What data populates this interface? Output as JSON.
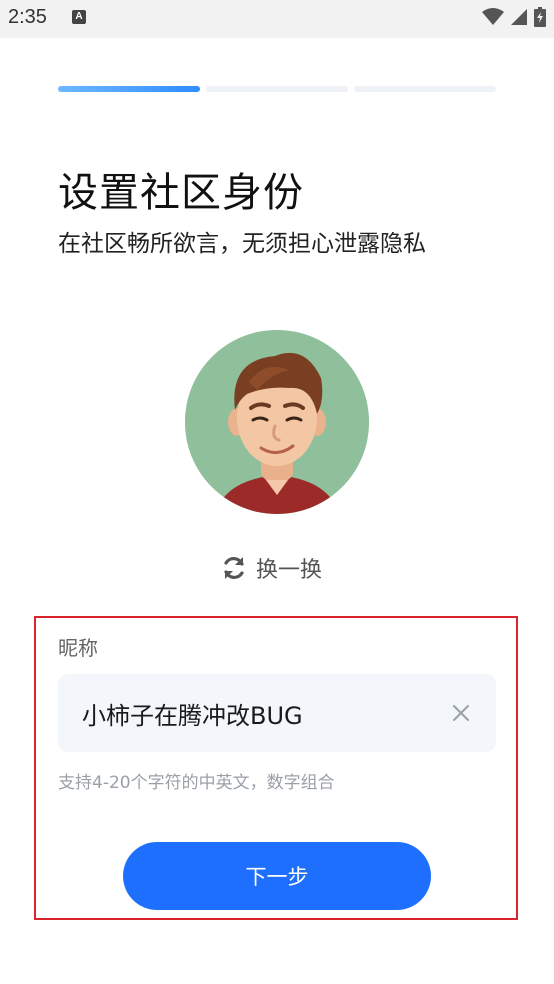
{
  "status_bar": {
    "time": "2:35",
    "notification_glyph": "A",
    "icons": [
      "wifi-icon",
      "signal-icon",
      "battery-icon"
    ]
  },
  "progress": {
    "steps": 3,
    "current_step": 1,
    "current_step_fill": 1.0,
    "accent_color": "#2f8cff"
  },
  "page": {
    "title": "设置社区身份",
    "subtitle": "在社区畅所欲言，无须担心泄露隐私"
  },
  "avatar": {
    "icon": "avatar-cartoon-man",
    "background_color": "#8fbf9b"
  },
  "swap_button": {
    "label": "换一换",
    "icon": "refresh-icon"
  },
  "nickname": {
    "label": "昵称",
    "value": "小柿子在腾冲改BUG",
    "clear_icon": "close-icon",
    "hint": "支持4-20个字符的中英文，数字组合"
  },
  "next_button": {
    "label": "下一步",
    "color": "#1f6fff"
  },
  "highlight_color": "#d8242b"
}
